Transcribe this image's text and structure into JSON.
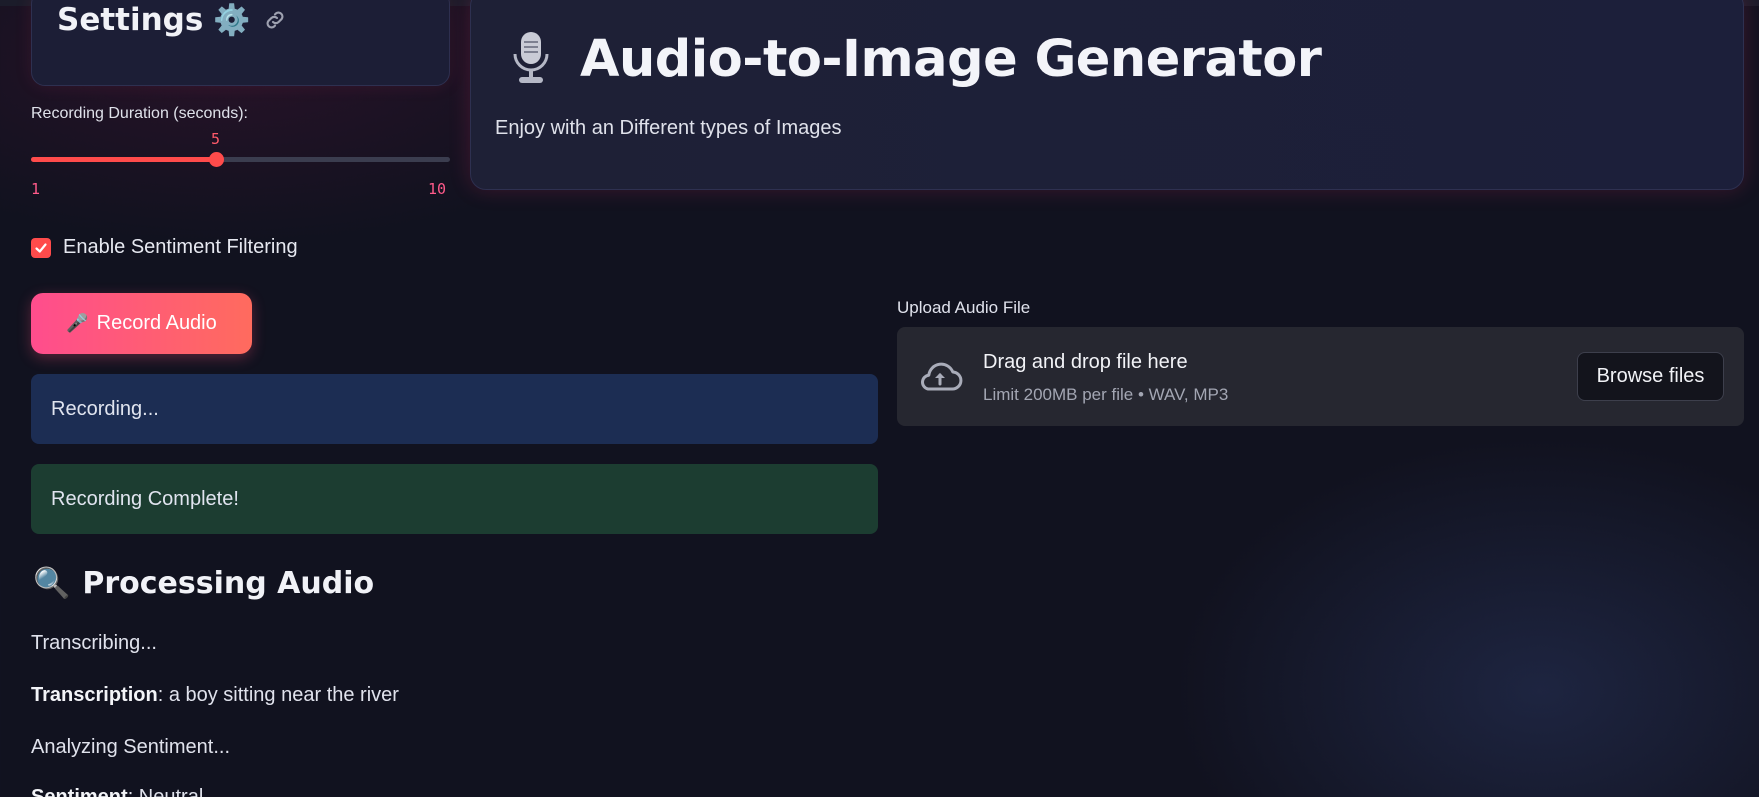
{
  "settings": {
    "title": "Settings",
    "gear_icon": "⚙️"
  },
  "slider": {
    "label": "Recording Duration (seconds):",
    "value": "5",
    "min": "1",
    "max": "10"
  },
  "checkbox": {
    "label": "Enable Sentiment Filtering",
    "checked": true
  },
  "record": {
    "icon": "🎤",
    "label": "Record Audio"
  },
  "alerts": {
    "recording": "Recording...",
    "complete": "Recording Complete!"
  },
  "processing": {
    "icon": "🔍",
    "title": "Processing Audio",
    "transcribing": "Transcribing...",
    "transcription_label": "Transcription",
    "transcription_value": ": a boy sitting near the river",
    "analyzing": "Analyzing Sentiment...",
    "sentiment_label": "Sentiment",
    "sentiment_value": ": Neutral"
  },
  "header": {
    "title": "Audio-to-Image Generator",
    "subtitle": "Enjoy with an Different types of Images"
  },
  "upload": {
    "label": "Upload Audio File",
    "drop_title": "Drag and drop file here",
    "drop_hint": "Limit 200MB per file • WAV, MP3",
    "browse_label": "Browse files"
  },
  "colors": {
    "accent": "#ff4b4b",
    "record_gradient_start": "#ff4d8d",
    "record_gradient_end": "#ff6b5e",
    "info_bg": "#1c2d53",
    "success_bg": "#1c3d31"
  }
}
